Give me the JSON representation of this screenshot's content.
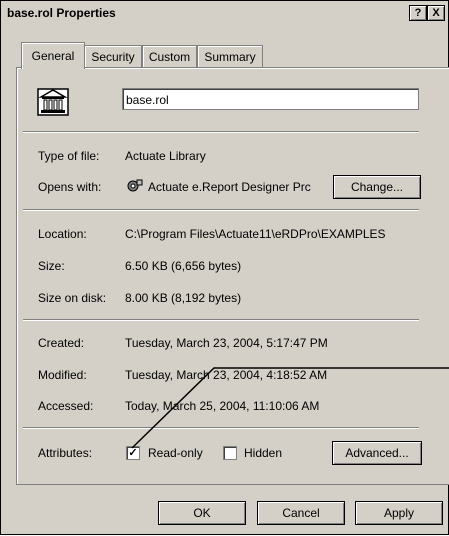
{
  "window": {
    "title": "base.rol Properties"
  },
  "title_buttons": {
    "help": "?",
    "close": "X"
  },
  "tabs": [
    {
      "label": "General"
    },
    {
      "label": "Security"
    },
    {
      "label": "Custom"
    },
    {
      "label": "Summary"
    }
  ],
  "file": {
    "name": "base.rol",
    "icon": "library-building-icon",
    "type_label": "Type of file:",
    "type_value": "Actuate Library",
    "opens_label": "Opens with:",
    "opens_value": "Actuate e.Report Designer Prc",
    "change_button": "Change...",
    "location_label": "Location:",
    "location_value": "C:\\Program Files\\Actuate11\\eRDPro\\EXAMPLES",
    "size_label": "Size:",
    "size_value": "6.50 KB (6,656 bytes)",
    "size_on_disk_label": "Size on disk:",
    "size_on_disk_value": "8.00 KB (8,192 bytes)",
    "created_label": "Created:",
    "created_value": "Tuesday, March 23, 2004, 5:17:47 PM",
    "modified_label": "Modified:",
    "modified_value": "Tuesday, March 23, 2004, 4:18:52 AM",
    "accessed_label": "Accessed:",
    "accessed_value": "Today, March 25, 2004, 11:10:06 AM"
  },
  "attributes": {
    "label": "Attributes:",
    "readonly_label": "Read-only",
    "readonly_checked": true,
    "hidden_label": "Hidden",
    "hidden_checked": false,
    "advanced_button": "Advanced..."
  },
  "footer": {
    "ok": "OK",
    "cancel": "Cancel",
    "apply": "Apply"
  },
  "check_mark": "✓"
}
